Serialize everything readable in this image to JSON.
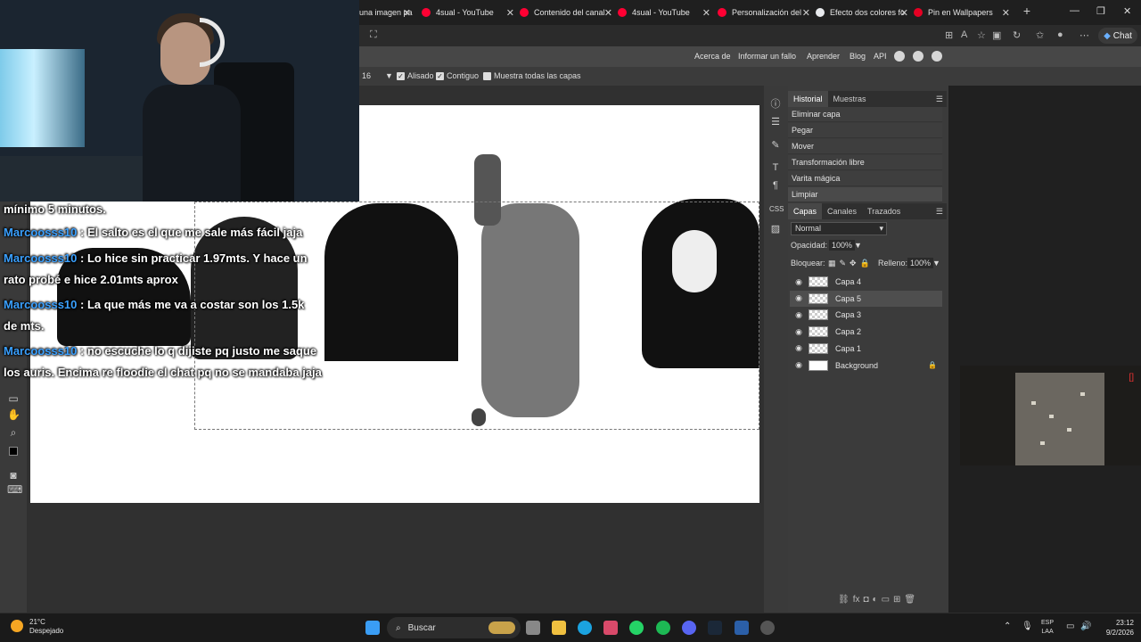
{
  "browser": {
    "tabs": [
      {
        "label": "una imagen pa",
        "favicon_color": "#e8eaed"
      },
      {
        "label": "4sual - YouTube",
        "favicon_color": "#ff0033"
      },
      {
        "label": "Contenido del canal",
        "favicon_color": "#ff0033"
      },
      {
        "label": "4sual - YouTube",
        "favicon_color": "#ff0033"
      },
      {
        "label": "Personalización del",
        "favicon_color": "#ff0033"
      },
      {
        "label": "Efecto dos colores fo",
        "favicon_color": "#e8eaed"
      },
      {
        "label": "Pin en Wallpapers",
        "favicon_color": "#e60023"
      }
    ],
    "chat_button": "Chat"
  },
  "photopea": {
    "menu_links": [
      "Acerca de",
      "Informar un fallo",
      "Aprender",
      "Blog",
      "API"
    ],
    "options": {
      "tolerance": "16",
      "antialias": "Alisado",
      "contiguous": "Contiguo",
      "sample_all": "Muestra todas las capas"
    },
    "history_tabs": [
      "Historial",
      "Muestras"
    ],
    "history_items": [
      "Eliminar capa",
      "Pegar",
      "Mover",
      "Transformación libre",
      "Varita mágica",
      "Limpiar"
    ],
    "layer_tabs": [
      "Capas",
      "Canales",
      "Trazados"
    ],
    "blend_mode": "Normal",
    "opacity_label": "Opacidad:",
    "opacity_value": "100%",
    "lock_label": "Bloquear:",
    "fill_label": "Relleno:",
    "fill_value": "100%",
    "layers": [
      {
        "name": "Capa 4",
        "selected": false,
        "locked": false
      },
      {
        "name": "Capa 5",
        "selected": true,
        "locked": false
      },
      {
        "name": "Capa 3",
        "selected": false,
        "locked": false
      },
      {
        "name": "Capa 2",
        "selected": false,
        "locked": false
      },
      {
        "name": "Capa 1",
        "selected": false,
        "locked": false
      },
      {
        "name": "Background",
        "selected": false,
        "locked": true
      }
    ]
  },
  "chat": {
    "lines": [
      {
        "user": "",
        "text": "mínimo 5 minutos."
      },
      {
        "user": "Marcoosss10",
        "text": " : El salto es el que me sale más fácil jaja"
      },
      {
        "user": "Marcoosss10",
        "text": " : Lo hice sin practicar 1.97mts. Y hace un"
      },
      {
        "user": "",
        "text": "rato probé e hice 2.01mts aprox"
      },
      {
        "user": "Marcoosss10",
        "text": " : La que más me va a costar son los 1.5k"
      },
      {
        "user": "",
        "text": "de mts."
      },
      {
        "user": "Marcoosss10",
        "text": " : no escuche lo q dijiste pq justo me saque"
      },
      {
        "user": "",
        "text": "los auris. Encima re floodie el chat pq no se mandaba jaja"
      }
    ]
  },
  "taskbar": {
    "weather_temp": "21°C",
    "weather_desc": "Despejado",
    "search_label": "Buscar",
    "lang_1": "ESP",
    "lang_2": "LAA",
    "time": "23:12",
    "date": "9/2/2026"
  }
}
